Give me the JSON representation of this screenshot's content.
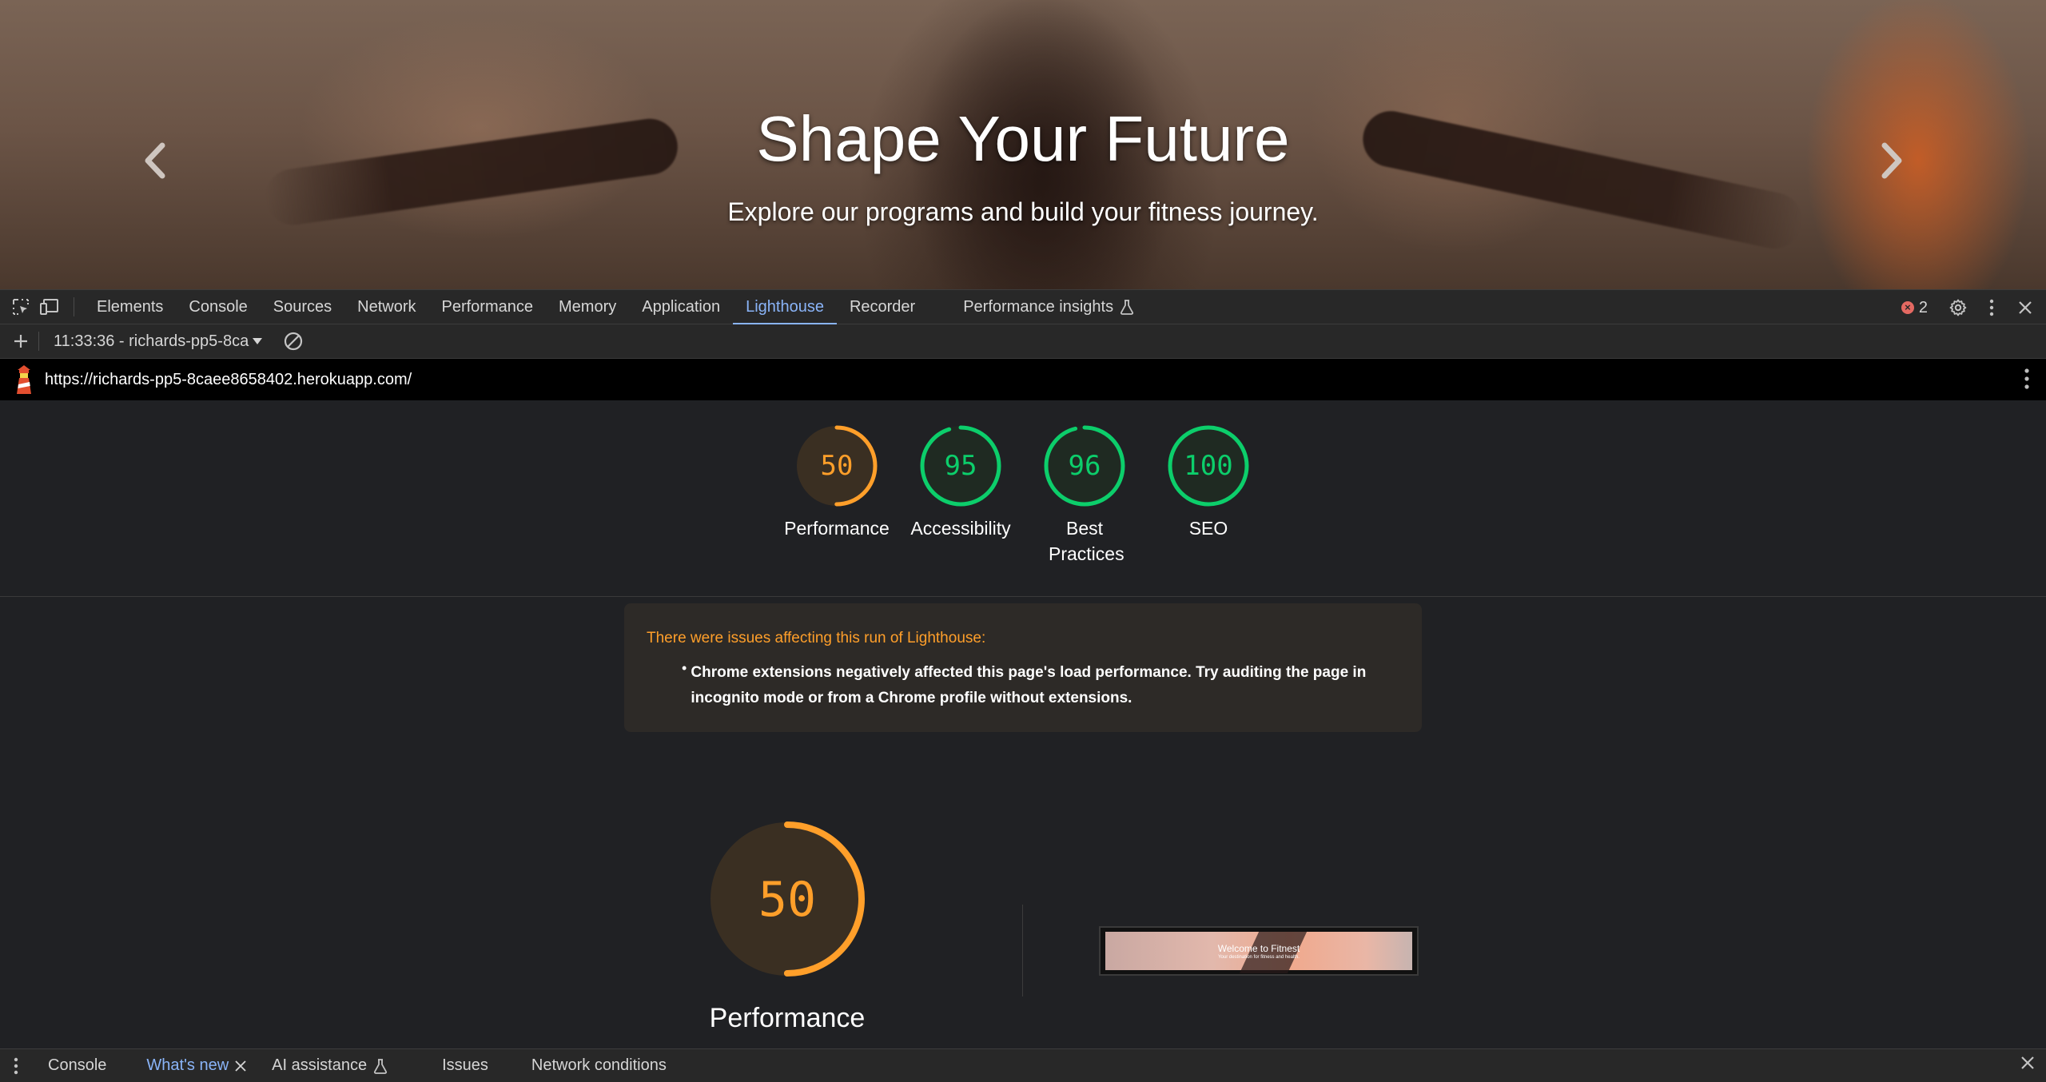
{
  "hero": {
    "title": "Shape Your Future",
    "subtitle": "Explore our programs and build your fitness journey."
  },
  "devtools": {
    "tabs": [
      "Elements",
      "Console",
      "Sources",
      "Network",
      "Performance",
      "Memory",
      "Application",
      "Lighthouse",
      "Recorder",
      "Performance insights"
    ],
    "active_tab": "Lighthouse",
    "error_count": "2"
  },
  "lighthouse": {
    "report_select": "11:33:36 - richards-pp5-8ca",
    "url": "https://richards-pp5-8caee8658402.herokuapp.com/",
    "scores": [
      {
        "value": "50",
        "label": "Performance",
        "color": "#ffa400"
      },
      {
        "value": "95",
        "label": "Accessibility",
        "color": "#0cce6b"
      },
      {
        "value": "96",
        "label": "Best Practices",
        "color": "#0cce6b"
      },
      {
        "value": "100",
        "label": "SEO",
        "color": "#0cce6b"
      }
    ],
    "warning": {
      "title": "There were issues affecting this run of Lighthouse:",
      "items": [
        "Chrome extensions negatively affected this page's load performance. Try auditing the page in incognito mode or from a Chrome profile without extensions."
      ]
    },
    "big_score": {
      "value": "50",
      "label": "Performance",
      "color": "#ffa400"
    },
    "thumbnail": {
      "title": "Welcome to Fitnest",
      "subtitle": "Your destination for fitness and health."
    }
  },
  "drawer": {
    "tabs": [
      "Console",
      "What's new",
      "AI assistance",
      "Issues",
      "Network conditions"
    ],
    "active_tab": "What's new"
  }
}
